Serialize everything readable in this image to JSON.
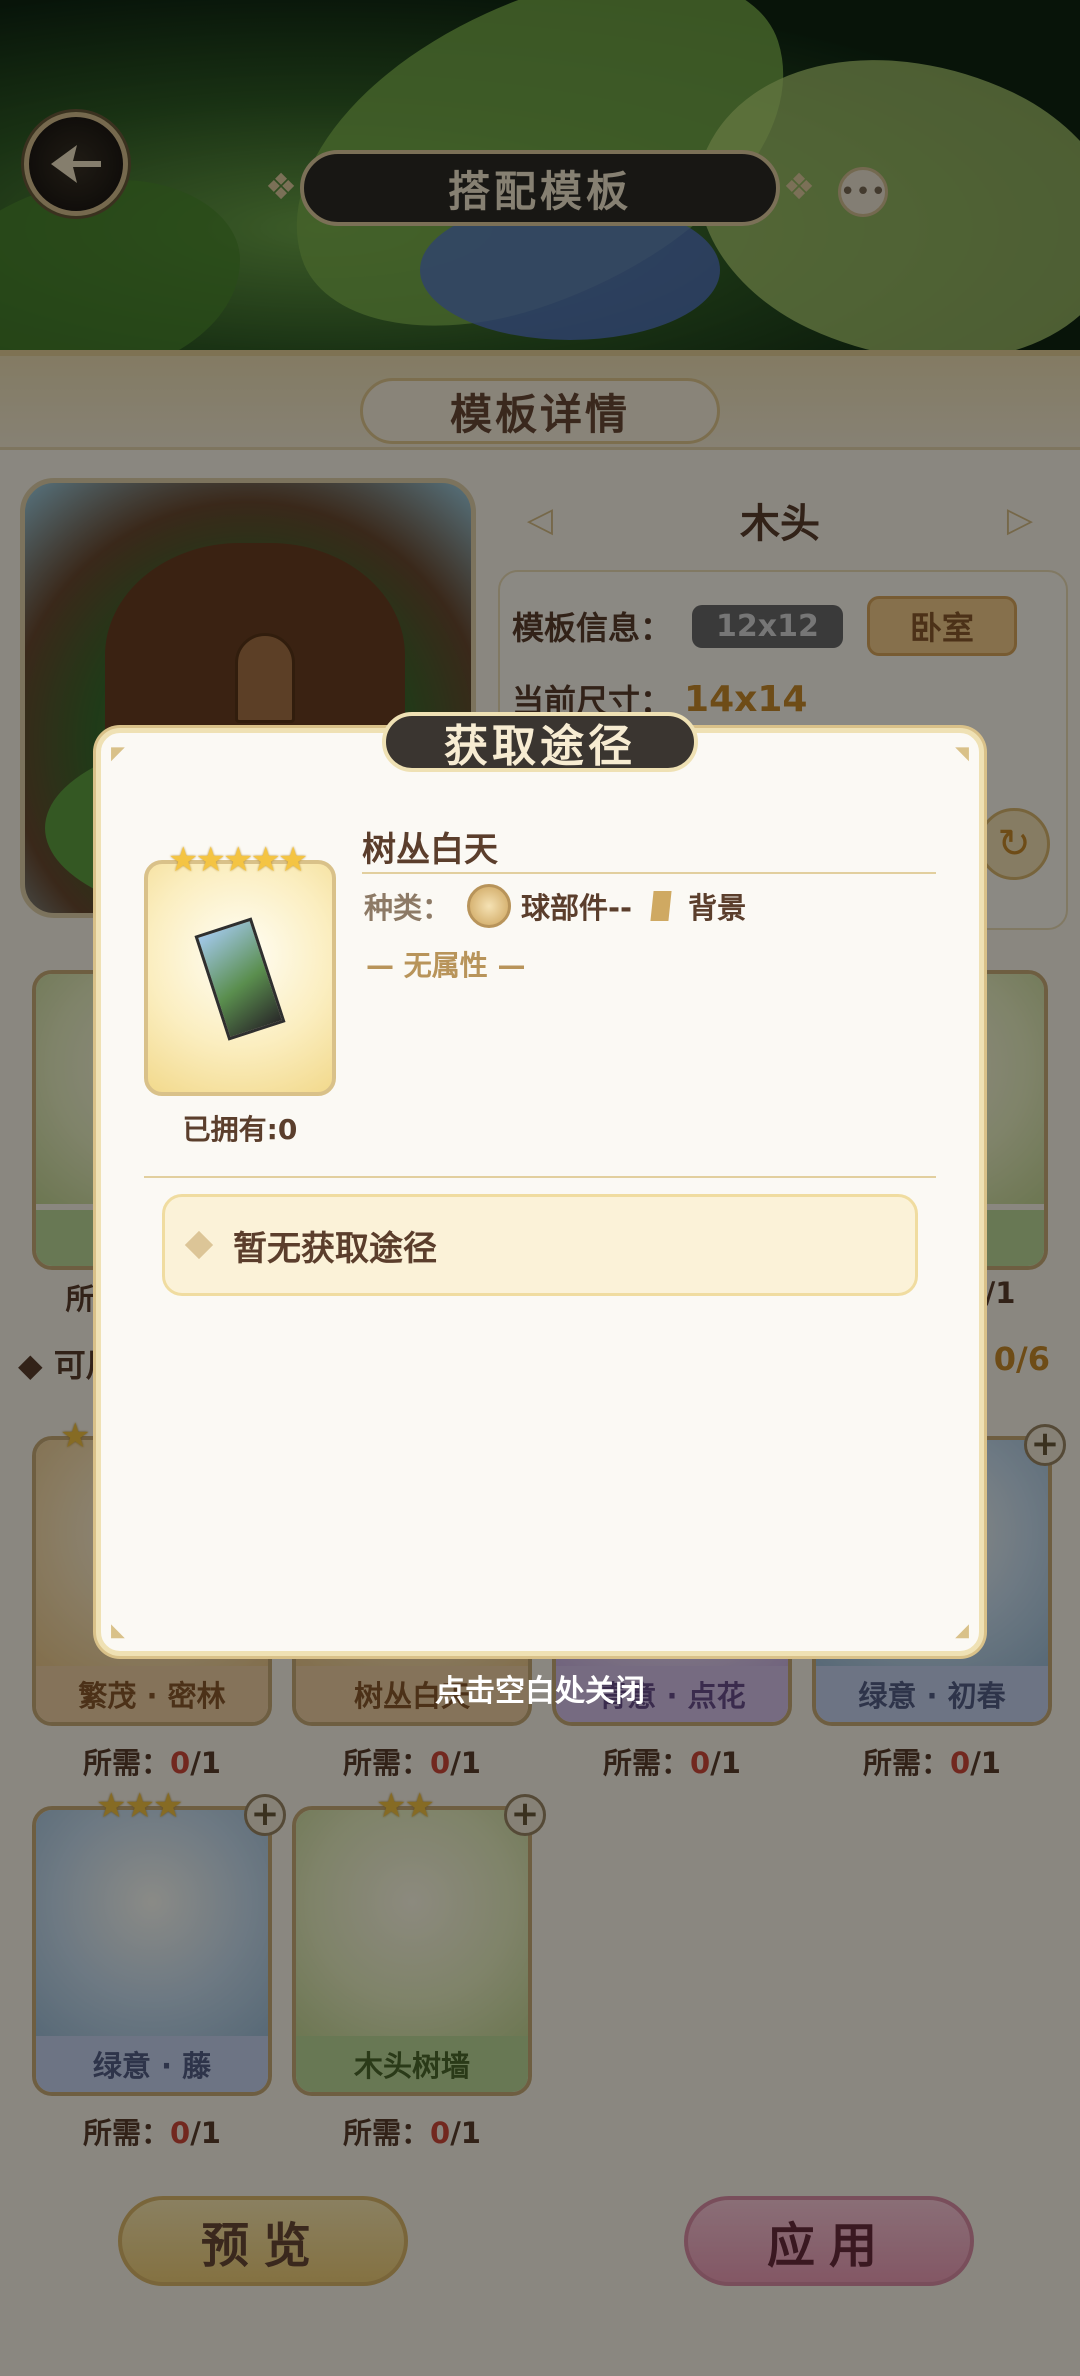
{
  "header": {
    "title": "搭配模板"
  },
  "section": {
    "title": "模板详情"
  },
  "template": {
    "name": "木头",
    "info_label": "模板信息：",
    "size_badge": "12x12",
    "room_badge": "卧室",
    "current_size_label": "当前尺寸：",
    "current_size_value": "14x14"
  },
  "available": {
    "title": "可用",
    "count": "0/6"
  },
  "cards_row1": [
    {
      "label": "繁茂 · 密林",
      "need_label": "所需：",
      "have": "0",
      "total": "/1"
    },
    {
      "label": "树丛白天",
      "need_label": "所需：",
      "have": "0",
      "total": "/1"
    },
    {
      "label": "青意 · 点花",
      "need_label": "所需：",
      "have": "0",
      "total": "/1"
    },
    {
      "label": "绿意 · 初春",
      "need_label": "所需：",
      "have": "0",
      "total": "/1"
    }
  ],
  "cards_row2": [
    {
      "label": "绿意 · 藤",
      "need_label": "所需：",
      "have": "0",
      "total": "/1"
    },
    {
      "label": "木头树墙",
      "need_label": "所需：",
      "have": "0",
      "total": "/1"
    }
  ],
  "top_row_partial": {
    "left_need": "所",
    "right_need": "/1"
  },
  "buttons": {
    "preview": "预览",
    "apply": "应用"
  },
  "dialog": {
    "title": "获取途径",
    "item_name": "树丛白天",
    "type_label": "种类：",
    "type_value": "球部件--",
    "type_sub": "背景",
    "attribute": "— 无属性 —",
    "owned": "已拥有:0",
    "no_way": "暂无获取途径",
    "stars": "★★★★★"
  },
  "close_hint": "点击空白处关闭",
  "stars": {
    "three": "★★★",
    "two": "★★",
    "one": "★"
  }
}
